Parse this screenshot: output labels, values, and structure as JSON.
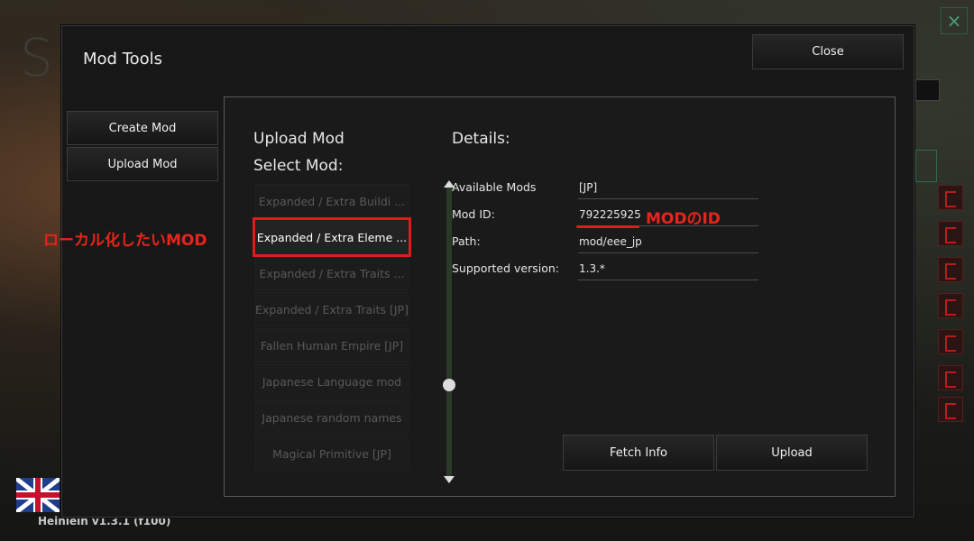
{
  "background": {
    "logo_letter": "S",
    "close_icon": "×",
    "version": "Heinlein v1.3.1 (f100)"
  },
  "dialog": {
    "title": "Mod Tools",
    "close_label": "Close",
    "nav": {
      "create_mod": "Create Mod",
      "upload_mod": "Upload Mod"
    }
  },
  "upload": {
    "title": "Upload Mod",
    "select_label": "Select Mod:",
    "mods": [
      {
        "label": "Expanded / Extra Buildi ...",
        "selected": false
      },
      {
        "label": "Expanded / Extra Eleme ...",
        "selected": true
      },
      {
        "label": "Expanded / Extra Traits ...",
        "selected": false
      },
      {
        "label": "Expanded / Extra Traits [JP]",
        "selected": false
      },
      {
        "label": "Fallen Human Empire [JP]",
        "selected": false
      },
      {
        "label": "Japanese Language mod",
        "selected": false
      },
      {
        "label": "Japanese random names",
        "selected": false
      },
      {
        "label": "Magical Primitive [JP]",
        "selected": false
      }
    ]
  },
  "details": {
    "title": "Details:",
    "available_mods_label": "Available Mods",
    "available_mods_value": "[JP]",
    "mod_id_label": "Mod ID:",
    "mod_id_value": "792225925",
    "path_label": "Path:",
    "path_value": "mod/eee_jp",
    "supported_version_label": "Supported version:",
    "supported_version_value": "1.3.*",
    "fetch_label": "Fetch Info",
    "upload_label": "Upload"
  },
  "annotations": {
    "left": "ローカル化したいMOD",
    "id": "MODのID",
    "color": "#e01b1b"
  }
}
